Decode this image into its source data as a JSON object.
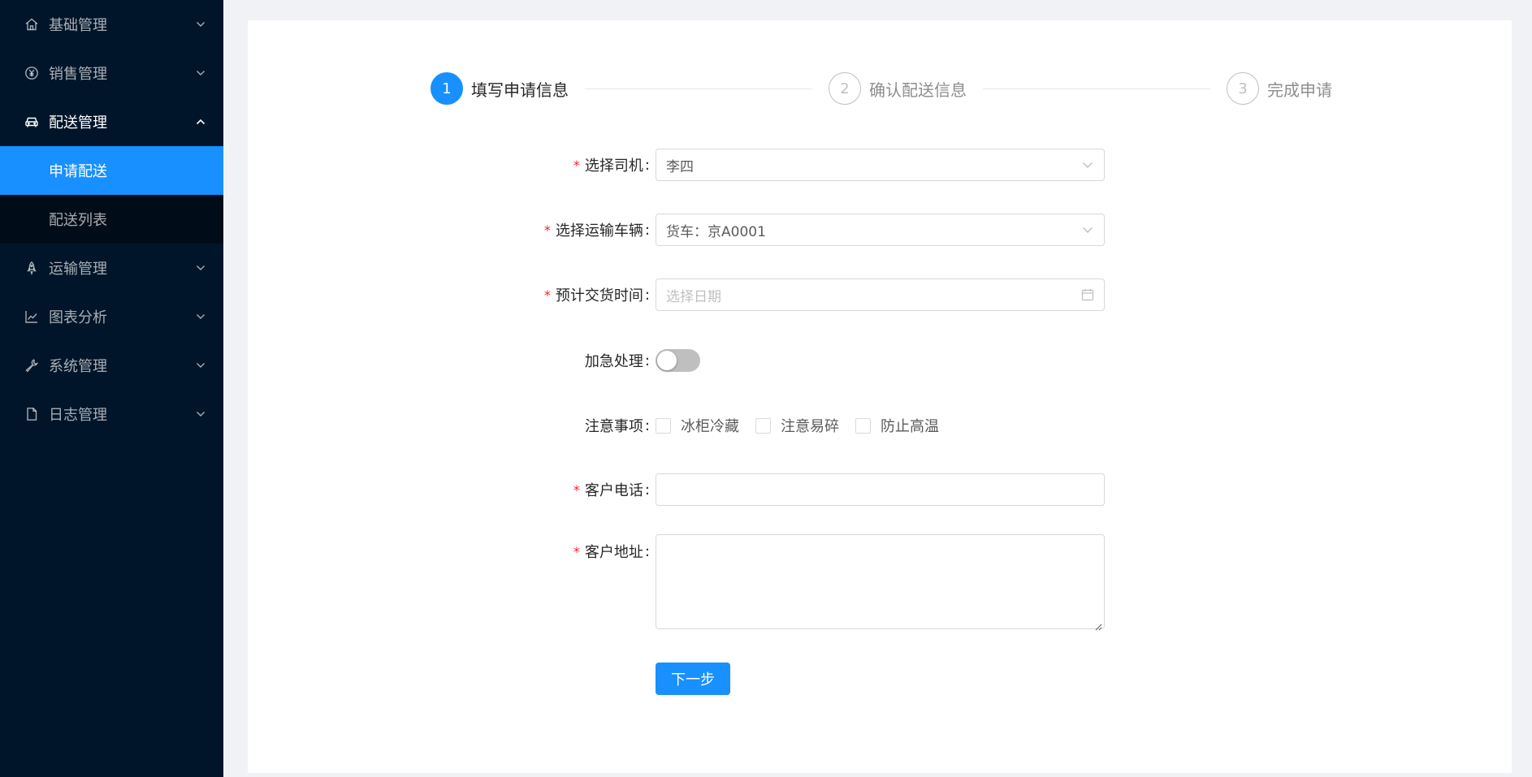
{
  "sidebar": {
    "items": [
      {
        "label": "基础管理",
        "icon": "home-icon"
      },
      {
        "label": "销售管理",
        "icon": "yen-circle-icon"
      },
      {
        "label": "配送管理",
        "icon": "car-icon",
        "open": true,
        "children": [
          {
            "label": "申请配送",
            "active": true
          },
          {
            "label": "配送列表"
          }
        ]
      },
      {
        "label": "运输管理",
        "icon": "rocket-icon"
      },
      {
        "label": "图表分析",
        "icon": "line-chart-icon"
      },
      {
        "label": "系统管理",
        "icon": "tool-icon"
      },
      {
        "label": "日志管理",
        "icon": "file-icon"
      }
    ]
  },
  "steps": [
    {
      "num": "1",
      "title": "填写申请信息"
    },
    {
      "num": "2",
      "title": "确认配送信息"
    },
    {
      "num": "3",
      "title": "完成申请"
    }
  ],
  "current_step": 1,
  "form": {
    "driver": {
      "label": "选择司机",
      "value": "李四",
      "required": true
    },
    "vehicle": {
      "label": "选择运输车辆",
      "value": "货车：京A0001",
      "required": true
    },
    "delivery_time": {
      "label": "预计交货时间",
      "placeholder": "选择日期",
      "required": true
    },
    "urgent": {
      "label": "加急处理",
      "on": false
    },
    "notes": {
      "label": "注意事项",
      "options": [
        "冰柜冷藏",
        "注意易碎",
        "防止高温"
      ]
    },
    "phone": {
      "label": "客户电话",
      "value": "",
      "required": true
    },
    "address": {
      "label": "客户地址",
      "value": "",
      "required": true
    },
    "next_button": "下一步"
  },
  "colors": {
    "sidebar_bg": "#001529",
    "submenu_bg": "#000c17",
    "primary": "#1890ff",
    "required": "#f5222d"
  }
}
